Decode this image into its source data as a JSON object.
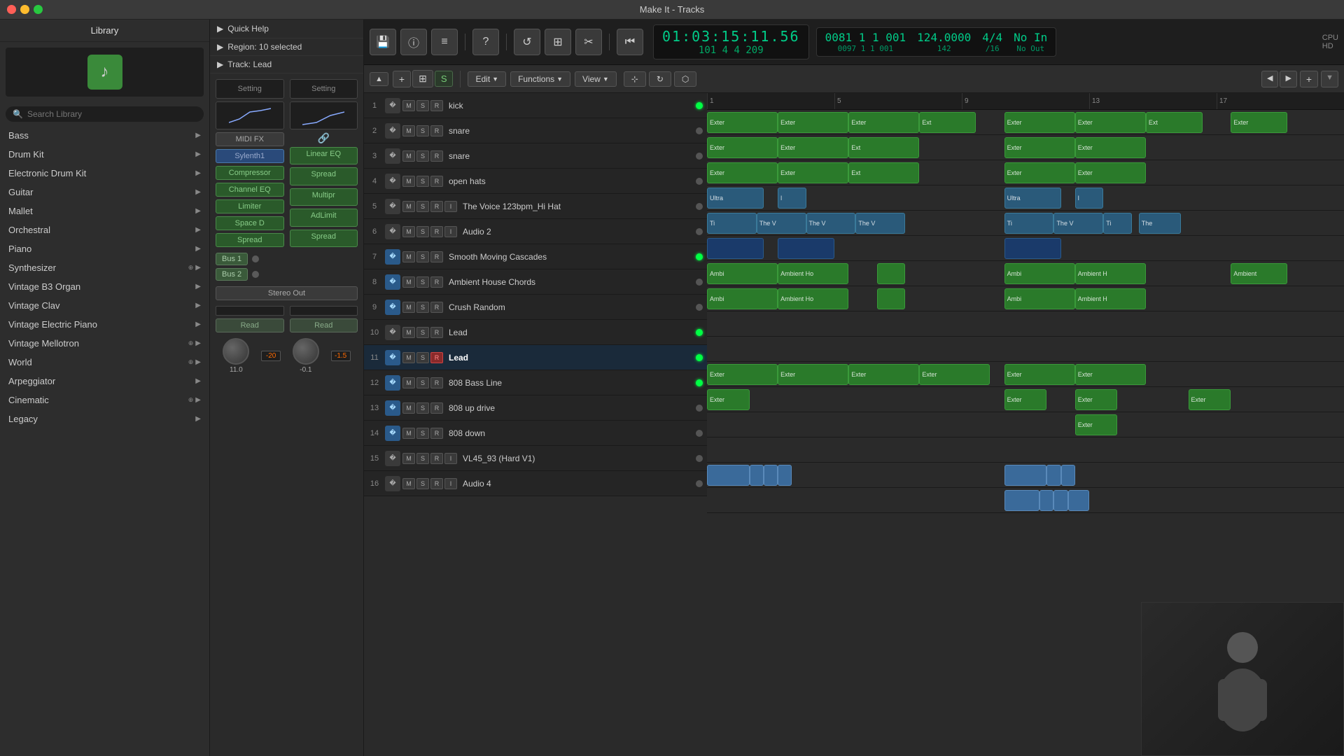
{
  "app": {
    "title": "Make It - Tracks"
  },
  "titlebar": {
    "close": "×",
    "min": "−",
    "max": "+"
  },
  "transport": {
    "time_main": "01:03:15:11.56",
    "time_sub": "101  4  4  209",
    "bpm_top": "0081  1  1  001",
    "bpm_sub": "0097  1  1  001",
    "bpm": "124.0000",
    "bpm2": "142",
    "time_sig": "4/4",
    "time_sig2": "/16",
    "no_in": "No In",
    "no_out": "No Out",
    "cpu_label": "CPU",
    "hd_label": "HD"
  },
  "toolbar": {
    "edit_label": "Edit",
    "functions_label": "Functions",
    "view_label": "View"
  },
  "library": {
    "header": "Library",
    "search_placeholder": "Search Library",
    "items": [
      {
        "name": "Bass",
        "has_arrow": true,
        "special": false
      },
      {
        "name": "Drum Kit",
        "has_arrow": true,
        "special": false
      },
      {
        "name": "Electronic Drum Kit",
        "has_arrow": true,
        "special": false
      },
      {
        "name": "Guitar",
        "has_arrow": true,
        "special": false
      },
      {
        "name": "Mallet",
        "has_arrow": true,
        "special": false
      },
      {
        "name": "Orchestral",
        "has_arrow": true,
        "special": false
      },
      {
        "name": "Piano",
        "has_arrow": true,
        "special": false
      },
      {
        "name": "Synthesizer",
        "has_arrow": true,
        "special": true
      },
      {
        "name": "Vintage B3 Organ",
        "has_arrow": true,
        "special": false
      },
      {
        "name": "Vintage Clav",
        "has_arrow": true,
        "special": false
      },
      {
        "name": "Vintage Electric Piano",
        "has_arrow": true,
        "special": false
      },
      {
        "name": "Vintage Mellotron",
        "has_arrow": true,
        "special": true
      },
      {
        "name": "World",
        "has_arrow": true,
        "special": true
      },
      {
        "name": "Arpeggiator",
        "has_arrow": true,
        "special": false
      },
      {
        "name": "Cinematic",
        "has_arrow": true,
        "special": true
      },
      {
        "name": "Legacy",
        "has_arrow": true,
        "special": false
      }
    ]
  },
  "middle_panel": {
    "quick_help": "Quick Help",
    "region": "Region: 10 selected",
    "track": "Track:  Lead",
    "setting1": "Setting",
    "setting2": "Setting",
    "sylenth1": "Sylenth1",
    "compressor": "Compressor",
    "channel_eq": "Channel EQ",
    "limiter": "Limiter",
    "space_d": "Space D",
    "spread1": "Spread",
    "linear_eq": "Linear EQ",
    "spread2": "Spread",
    "multipr": "Multipr",
    "adlimit": "AdLimit",
    "spread3": "Spread",
    "midi_fx": "MIDI FX",
    "bus1": "Bus 1",
    "bus2": "Bus 2",
    "stereo_out": "Stereo Out",
    "read1": "Read",
    "read2": "Read",
    "knob1_val": "11.0",
    "fader1_val": "-20",
    "knob2_val": "-0.1",
    "fader2_val": "-1.5"
  },
  "tracks": [
    {
      "num": 1,
      "name": "kick",
      "icon": "drum",
      "m": "M",
      "s": "S",
      "r": "R",
      "i": "",
      "r_active": false,
      "ind": "green",
      "has_i": false
    },
    {
      "num": 2,
      "name": "snare",
      "icon": "drum",
      "m": "M",
      "s": "S",
      "r": "R",
      "i": "",
      "r_active": false,
      "ind": "gray",
      "has_i": false
    },
    {
      "num": 3,
      "name": "snare",
      "icon": "drum",
      "m": "M",
      "s": "S",
      "r": "R",
      "i": "",
      "r_active": false,
      "ind": "gray",
      "has_i": false
    },
    {
      "num": 4,
      "name": "open hats",
      "icon": "drum",
      "m": "M",
      "s": "S",
      "r": "R",
      "i": "",
      "r_active": false,
      "ind": "gray",
      "has_i": false
    },
    {
      "num": 5,
      "name": "The Voice 123bpm_Hi Hat",
      "icon": "audio",
      "m": "M",
      "s": "S",
      "r": "R",
      "i": "I",
      "r_active": false,
      "ind": "gray",
      "has_i": true
    },
    {
      "num": 6,
      "name": "Audio 2",
      "icon": "audio",
      "m": "M",
      "s": "S",
      "r": "R",
      "i": "I",
      "r_active": false,
      "ind": "gray",
      "has_i": true
    },
    {
      "num": 7,
      "name": "Smooth Moving Cascades",
      "icon": "synth",
      "m": "M",
      "s": "S",
      "r": "R",
      "i": "",
      "r_active": false,
      "ind": "green",
      "has_i": false
    },
    {
      "num": 8,
      "name": "Ambient House Chords",
      "icon": "synth",
      "m": "M",
      "s": "S",
      "r": "R",
      "i": "",
      "r_active": false,
      "ind": "gray",
      "has_i": false
    },
    {
      "num": 9,
      "name": "Crush Random",
      "icon": "synth",
      "m": "M",
      "s": "S",
      "r": "R",
      "i": "",
      "r_active": false,
      "ind": "gray",
      "has_i": false
    },
    {
      "num": 10,
      "name": "Lead",
      "icon": "audio",
      "m": "M",
      "s": "S",
      "r": "R",
      "i": "",
      "r_active": false,
      "ind": "green",
      "has_i": false
    },
    {
      "num": 11,
      "name": "Lead",
      "icon": "synth",
      "m": "M",
      "s": "S",
      "r": "R",
      "i": "",
      "r_active": true,
      "ind": "green",
      "has_i": false,
      "active": true
    },
    {
      "num": 12,
      "name": "808 Bass Line",
      "icon": "synth",
      "m": "M",
      "s": "S",
      "r": "R",
      "i": "",
      "r_active": false,
      "ind": "green",
      "has_i": false
    },
    {
      "num": 13,
      "name": "808 up drive",
      "icon": "synth",
      "m": "M",
      "s": "S",
      "r": "R",
      "i": "",
      "r_active": false,
      "ind": "gray",
      "has_i": false
    },
    {
      "num": 14,
      "name": "808 down",
      "icon": "synth",
      "m": "M",
      "s": "S",
      "r": "R",
      "i": "",
      "r_active": false,
      "ind": "gray",
      "has_i": false
    },
    {
      "num": 15,
      "name": "VL45_93 (Hard V1)",
      "icon": "audio",
      "m": "M",
      "s": "S",
      "r": "R",
      "i": "I",
      "r_active": false,
      "ind": "gray",
      "has_i": true
    },
    {
      "num": 16,
      "name": "Audio 4",
      "icon": "audio",
      "m": "M",
      "s": "S",
      "r": "R",
      "i": "I",
      "r_active": false,
      "ind": "gray",
      "has_i": true
    }
  ],
  "ruler": {
    "marks": [
      "1",
      "5",
      "9",
      "13",
      "17"
    ]
  },
  "colors": {
    "accent_green": "#00ff44",
    "accent_teal": "#00cc88",
    "clip_green": "#2a7a2a",
    "clip_blue": "#1a3a6a",
    "clip_teal": "#2a5a7a"
  }
}
